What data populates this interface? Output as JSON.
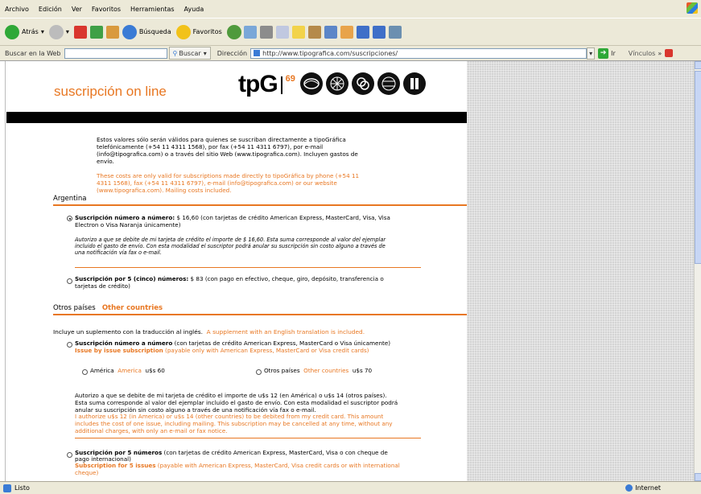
{
  "menu": [
    "Archivo",
    "Edición",
    "Ver",
    "Favoritos",
    "Herramientas",
    "Ayuda"
  ],
  "toolbar": {
    "back": "Atrás",
    "search": "Búsqueda",
    "favorites": "Favoritos"
  },
  "searchbar": {
    "label": "Buscar en la Web",
    "search_button": "Buscar",
    "address_label": "Dirección",
    "url": "http://www.tipografica.com/suscripciones/",
    "go": "Ir",
    "links": "Vínculos"
  },
  "header": {
    "title": "suscripción on line",
    "logo": "tpG",
    "logo_number": "69"
  },
  "intro": {
    "es": [
      "Estos valores sólo serán válidos para quienes se suscriban directamente a tipoGráfica",
      "telefónicamente (+54 11 4311 1568), por fax (+54 11 4311 6797), por e-mail",
      "(info@tipografica.com) o a través del sitio Web (www.tipografica.com). Incluyen gastos de",
      "envío."
    ],
    "en": [
      "These costs are only valid for subscriptions made directly to tipoGráfica by phone (+54 11",
      "4311 1568), fax (+54 11 4311 6797), e-mail (info@tipografica.com) or our website",
      "(www.tipografica.com). Mailing costs included."
    ]
  },
  "argentina": {
    "heading": "Argentina",
    "opt1": {
      "label": "Suscripción número a número:",
      "text1": " $ 16,60 (con tarjetas de crédito American Express, MasterCard, Visa, Visa",
      "text2": "Electron o Visa Naranja únicamente)"
    },
    "auth": [
      "Autorizo a que se debite de mi tarjeta de crédito el importe de $ 16,60. Esta suma corresponde al valor del ejemplar",
      "incluido el gasto de envío. Con esta modalidad el suscriptor podrá anular su suscripción sin costo alguno a través de",
      "una notificación vía fax o e-mail."
    ],
    "opt2": {
      "label": "Suscripción por 5 (cinco) números:",
      "text1": " $ 83 (con pago en efectivo, cheque, giro, depósito, transferencia o",
      "text2": "tarjetas de crédito)"
    }
  },
  "other": {
    "heading_es": "Otros países",
    "heading_en": "Other countries",
    "supp_es": "Incluye un suplemento con la traducción al inglés.",
    "supp_en": "A supplement with an English translation is included.",
    "opt1": {
      "label": "Suscripción número a número",
      "text": " (con tarjetas de crédito American Express, MasterCard o Visa únicamente)",
      "label_en": "Issue by issue subscription",
      "text_en": " (payable only with American Express, MasterCard or Visa credit cards)"
    },
    "america": {
      "es": "América",
      "en": "America",
      "price": "u$s 60"
    },
    "otros": {
      "es": "Otros países",
      "en": "Other countries",
      "price": "u$s 70"
    },
    "auth_es": [
      "Autorizo a que se debite de mi tarjeta de crédito el importe de u$s 12 (en América) o u$s 14 (otros países).",
      "Esta suma corresponde al valor del ejemplar incluido el gasto de envío. Con esta modalidad el suscriptor podrá",
      "anular su suscripción sin costo alguno a través de una notificación vía fax o e-mail."
    ],
    "auth_en": [
      "I authorize u$s 12 (in America) or u$s 14 (other countries) to be debited from my credit card. This amount",
      "includes the cost of one issue, including mailing. This subscription may be cancelled at any time, without any",
      "additional charges, with only an e-mail or fax notice."
    ],
    "opt2": {
      "label": "Suscripción por 5 números",
      "text1": " (con tarjetas de crédito American Express, MasterCard, Visa o con cheque de",
      "text2": "pago internacional)",
      "label_en": "Subscription for 5 issues",
      "text_en1": " (payable with American Express, MasterCard, Visa credit cards or with international",
      "text_en2": "cheque)"
    }
  },
  "status": {
    "left": "Listo",
    "zone": "Internet"
  },
  "colors": {
    "accent": "#e87722",
    "chrome": "#ece9d8"
  }
}
